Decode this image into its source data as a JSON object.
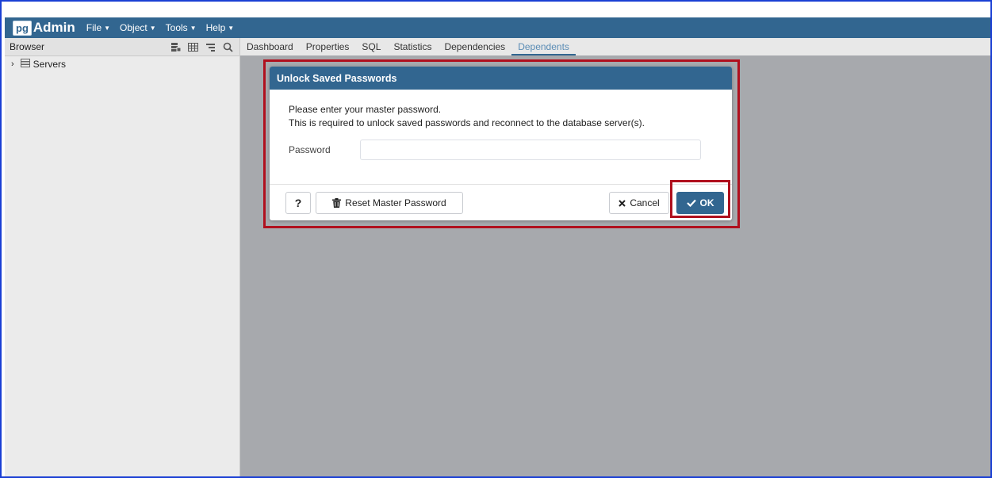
{
  "app": {
    "logo_prefix": "pg",
    "logo_name": "Admin",
    "menu": [
      {
        "label": "File"
      },
      {
        "label": "Object"
      },
      {
        "label": "Tools"
      },
      {
        "label": "Help"
      }
    ]
  },
  "sidebar": {
    "title": "Browser",
    "tools": [
      "object-explorer-icon",
      "table-grid-icon",
      "tree-filter-icon",
      "search-icon"
    ],
    "tree": [
      {
        "label": "Servers",
        "expanded": false
      }
    ]
  },
  "tabs": [
    {
      "label": "Dashboard"
    },
    {
      "label": "Properties"
    },
    {
      "label": "SQL"
    },
    {
      "label": "Statistics"
    },
    {
      "label": "Dependencies"
    },
    {
      "label": "Dependents",
      "active": true
    }
  ],
  "dialog": {
    "title": "Unlock Saved Passwords",
    "line1": "Please enter your master password.",
    "line2": "This is required to unlock saved passwords and reconnect to the database server(s).",
    "password_label": "Password",
    "password_value": "",
    "help_label": "?",
    "reset_label": "Reset Master Password",
    "cancel_label": "Cancel",
    "ok_label": "OK"
  },
  "colors": {
    "brand": "#326690",
    "highlight": "#b0101e",
    "frame": "#1a3fd4"
  }
}
